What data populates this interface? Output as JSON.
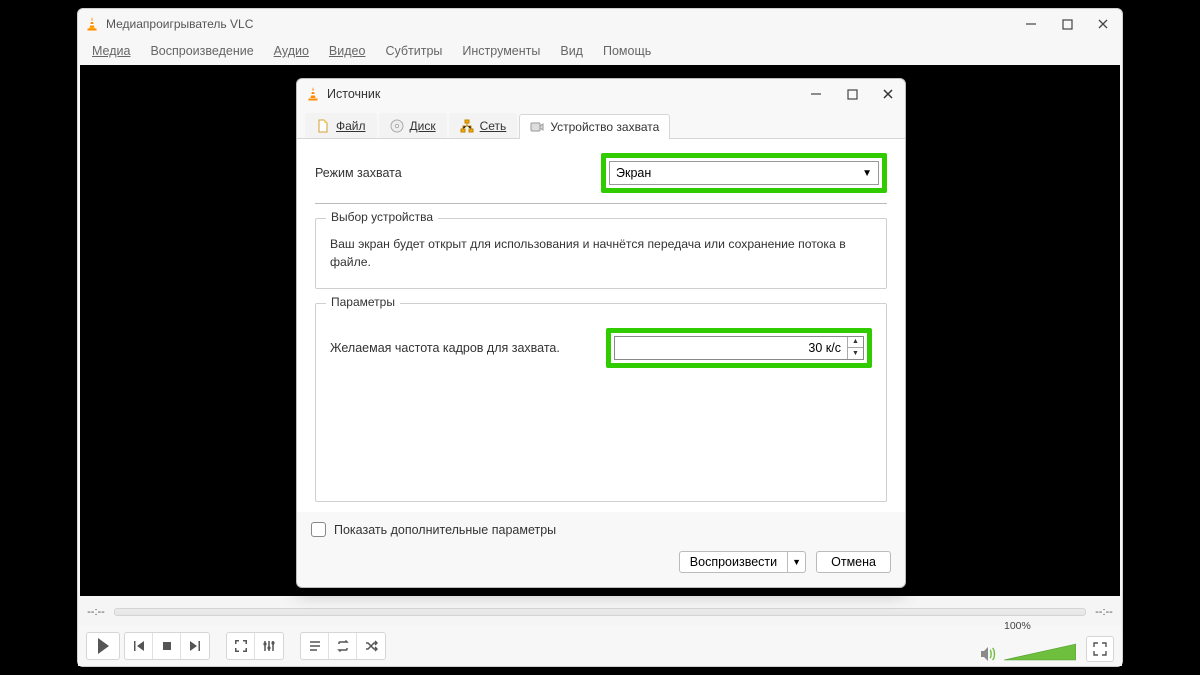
{
  "main_window": {
    "title": "Медиапроигрыватель VLC",
    "menu": {
      "media": "Медиа",
      "playback": "Воспроизведение",
      "audio": "Аудио",
      "video": "Видео",
      "subtitles": "Субтитры",
      "tools": "Инструменты",
      "view": "Вид",
      "help": "Помощь"
    },
    "time_left": "--:--",
    "time_right": "--:--",
    "volume_label": "100%"
  },
  "dialog": {
    "title": "Источник",
    "tabs": {
      "file": "Файл",
      "disc": "Диск",
      "network": "Сеть",
      "capture": "Устройство захвата"
    },
    "capture_mode_label": "Режим захвата",
    "capture_mode_value": "Экран",
    "device_group": {
      "legend": "Выбор устройства",
      "description": "Ваш экран будет открыт для использования и начнётся передача или сохранение потока в файле."
    },
    "params_group": {
      "legend": "Параметры",
      "fps_label": "Желаемая частота кадров для захвата.",
      "fps_value": "30 к/с"
    },
    "show_more_label": "Показать дополнительные параметры",
    "play_button": "Воспроизвести",
    "cancel_button": "Отмена"
  }
}
